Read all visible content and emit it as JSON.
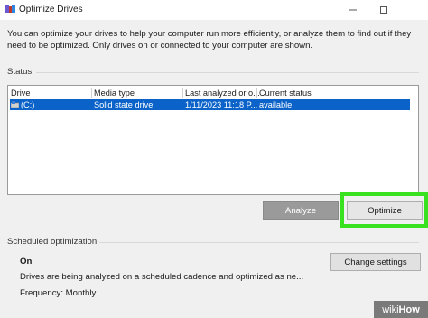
{
  "window": {
    "title": "Optimize Drives",
    "minimize_icon": "minimize-icon",
    "maximize_icon": "maximize-icon"
  },
  "description": "You can optimize your drives to help your computer run more efficiently, or analyze them to find out if they need to be optimized. Only drives on or connected to your computer are shown.",
  "status": {
    "label": "Status",
    "columns": [
      "Drive",
      "Media type",
      "Last analyzed or o...",
      "Current status"
    ],
    "rows": [
      {
        "drive": "(C:)",
        "media_type": "Solid state drive",
        "last_analyzed": "1/11/2023 11:18 P...",
        "current_status": "available",
        "selected": true
      }
    ],
    "accent": "#0b62c9"
  },
  "buttons": {
    "analyze": "Analyze",
    "optimize": "Optimize",
    "change_settings": "Change settings"
  },
  "highlight_color": "#38e21f",
  "scheduled": {
    "label": "Scheduled optimization",
    "state": "On",
    "detail": "Drives are being analyzed on a scheduled cadence and optimized as ne...",
    "frequency": "Frequency: Monthly"
  },
  "watermark": {
    "prefix": "wiki",
    "suffix": "How"
  }
}
